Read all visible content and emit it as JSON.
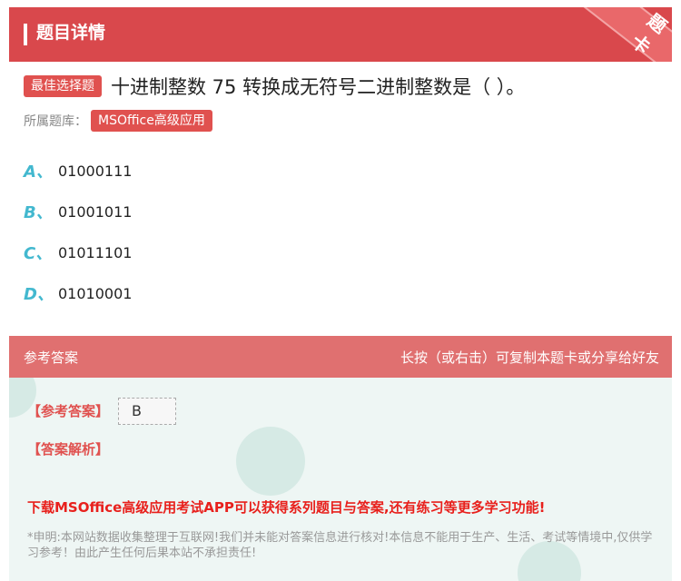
{
  "header": {
    "title": "题目详情",
    "corner_label": "题卡"
  },
  "question": {
    "type_badge": "最佳选择题",
    "text": "十进制整数 75 转换成无符号二进制整数是（   ）。",
    "bank_label": "所属题库：",
    "bank_name": "MSOffice高级应用"
  },
  "options": [
    {
      "letter": "A、",
      "text": "01000111"
    },
    {
      "letter": "B、",
      "text": "01001011"
    },
    {
      "letter": "C、",
      "text": "01011101"
    },
    {
      "letter": "D、",
      "text": "01010001"
    }
  ],
  "answer_section": {
    "header_left": "参考答案",
    "header_right": "长按（或右击）可复制本题卡或分享给好友",
    "answer_label": "【参考答案】",
    "answer_value": "B",
    "analysis_label": "【答案解析】",
    "promo": "下载MSOffice高级应用考试APP可以获得系列题目与答案,还有练习等更多学习功能!",
    "disclaimer": "*申明:本网站数据收集整理于互联网!我们并未能对答案信息进行核对!本信息不能用于生产、生活、考试等情境中,仅供学习参考！由此产生任何后果本站不承担责任!"
  },
  "colors": {
    "brand_red": "#d9484c",
    "option_letter": "#43b8cf",
    "panel_bg": "#eef6f4"
  }
}
